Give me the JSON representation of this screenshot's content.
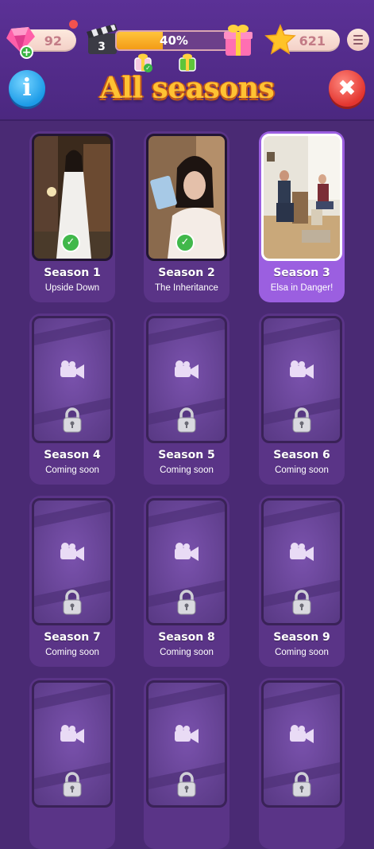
{
  "header": {
    "gems": "92",
    "level": "3",
    "progress_label": "40%",
    "progress_value": 0.4,
    "stars": "621",
    "title": "All seasons",
    "info_label": "i",
    "close_label": "✖"
  },
  "seasons": [
    {
      "name": "Season 1",
      "subtitle": "Upside Down",
      "state": "completed"
    },
    {
      "name": "Season 2",
      "subtitle": "The Inheritance",
      "state": "completed"
    },
    {
      "name": "Season 3",
      "subtitle": "Elsa in Danger!",
      "state": "current"
    },
    {
      "name": "Season 4",
      "subtitle": "Coming soon",
      "state": "locked"
    },
    {
      "name": "Season 5",
      "subtitle": "Coming soon",
      "state": "locked"
    },
    {
      "name": "Season 6",
      "subtitle": "Coming soon",
      "state": "locked"
    },
    {
      "name": "Season 7",
      "subtitle": "Coming soon",
      "state": "locked"
    },
    {
      "name": "Season 8",
      "subtitle": "Coming soon",
      "state": "locked"
    },
    {
      "name": "Season 9",
      "subtitle": "Coming soon",
      "state": "locked"
    },
    {
      "name": "",
      "subtitle": "",
      "state": "locked"
    },
    {
      "name": "",
      "subtitle": "",
      "state": "locked"
    },
    {
      "name": "",
      "subtitle": "",
      "state": "locked"
    }
  ],
  "colors": {
    "background": "#4a2a74",
    "card": "#5a3487",
    "selected_card": "#9b5fe0",
    "title": "#ffc233",
    "progress_fill": "#f8b02a"
  },
  "icons": [
    "gem-icon",
    "plus-icon",
    "clapperboard-icon",
    "gift-icon",
    "star-icon",
    "menu-icon",
    "info-icon",
    "close-icon",
    "check-icon",
    "camera-icon",
    "lock-icon"
  ]
}
